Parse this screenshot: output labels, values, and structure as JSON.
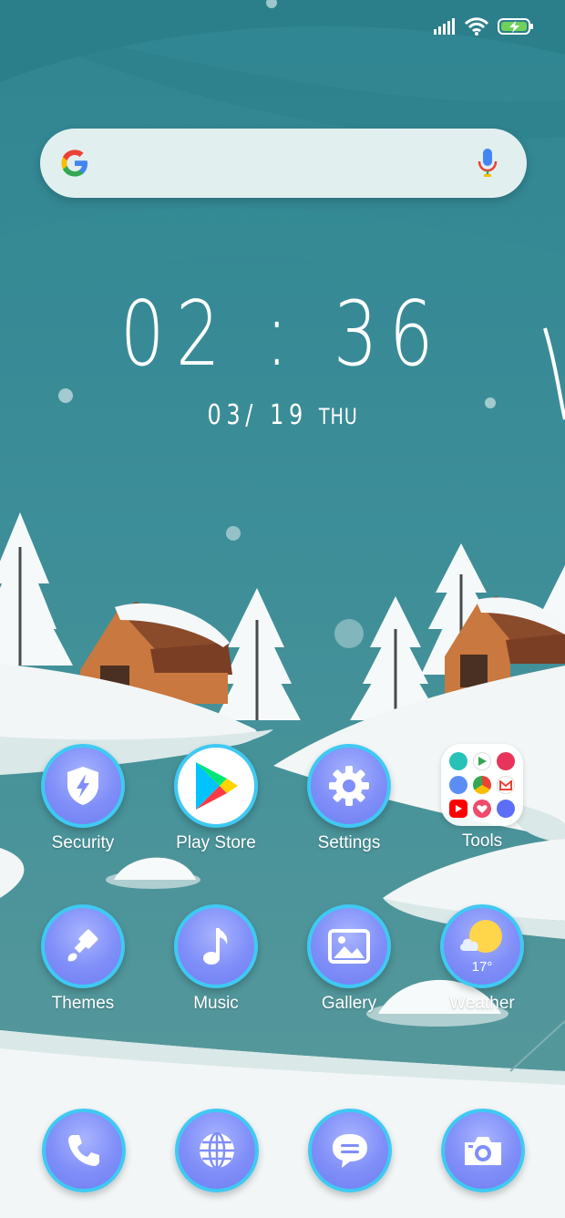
{
  "status_bar": {
    "signal_icon": "signal-bars-icon",
    "wifi_icon": "wifi-icon",
    "battery_icon": "battery-charging-icon"
  },
  "search": {
    "logo_icon": "google-g-logo",
    "mic_icon": "microphone-icon"
  },
  "clock": {
    "time": "02 : 36",
    "date": "03/ 19",
    "weekday": "THU"
  },
  "apps": {
    "security": {
      "label": "Security",
      "icon": "shield-bolt-icon"
    },
    "play_store": {
      "label": "Play Store",
      "icon": "play-store-icon"
    },
    "settings": {
      "label": "Settings",
      "icon": "gear-icon"
    },
    "tools": {
      "label": "Tools",
      "icon": "folder-icon"
    },
    "themes": {
      "label": "Themes",
      "icon": "paintbrush-icon"
    },
    "music": {
      "label": "Music",
      "icon": "music-note-icon"
    },
    "gallery": {
      "label": "Gallery",
      "icon": "image-icon"
    },
    "weather": {
      "label": "Weather",
      "icon": "sun-cloud-icon",
      "temp": "17°"
    }
  },
  "dock": {
    "phone": {
      "icon": "phone-icon"
    },
    "browser": {
      "icon": "globe-icon"
    },
    "messages": {
      "icon": "chat-bubble-icon"
    },
    "camera": {
      "icon": "camera-icon"
    }
  },
  "colors": {
    "sky": "#3a8b95",
    "snow": "#f2f6f6",
    "icon_fill": "#7f8ef8",
    "icon_ring": "#3fc9f3"
  }
}
